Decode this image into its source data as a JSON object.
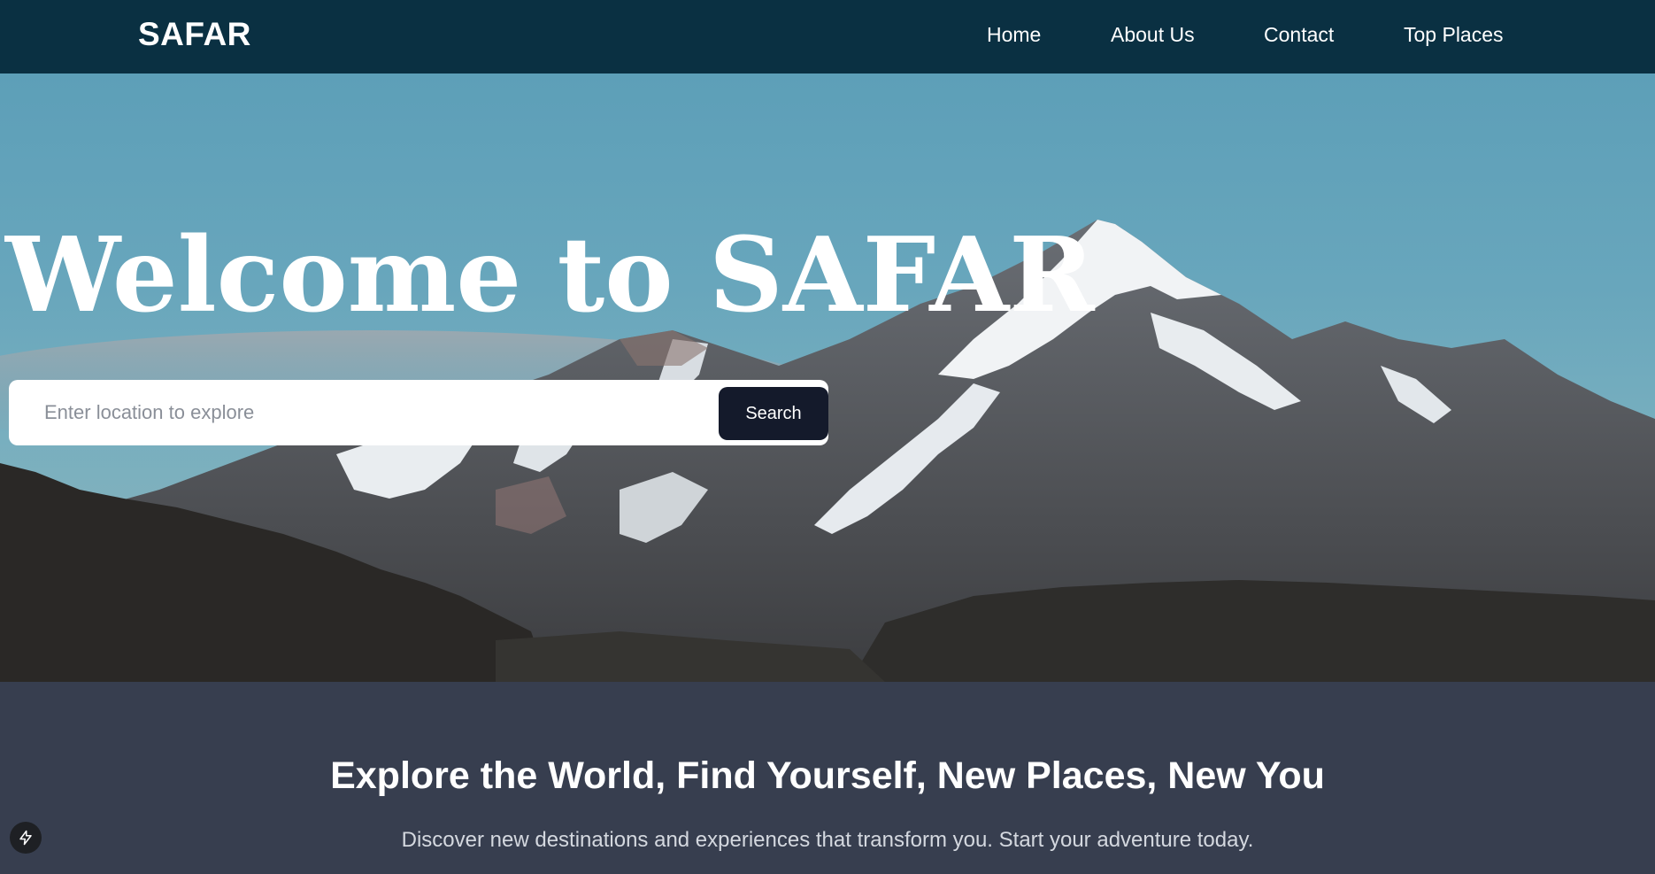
{
  "navbar": {
    "brand": "SAFAR",
    "links": [
      {
        "label": "Home"
      },
      {
        "label": "About Us"
      },
      {
        "label": "Contact"
      },
      {
        "label": "Top Places"
      }
    ]
  },
  "hero": {
    "title": "Welcome to SAFAR",
    "search_placeholder": "Enter location to explore",
    "search_button": "Search"
  },
  "tagline": {
    "heading": "Explore the World, Find Yourself, New Places, New You",
    "subheading": "Discover new destinations and experiences that transform you. Start your adventure today."
  },
  "colors": {
    "navbar_bg": "#0a3042",
    "section_bg": "#373e4f",
    "button_bg": "#141a2b"
  },
  "icons": {
    "dev_badge": "lightning-bolt-icon"
  }
}
